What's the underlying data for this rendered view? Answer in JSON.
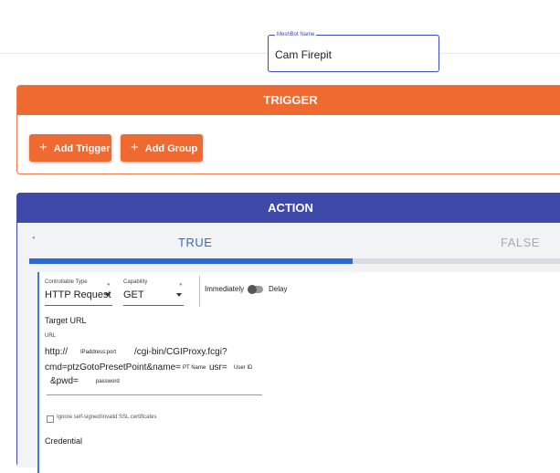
{
  "meshbot_name": {
    "label": "MeshBot Name",
    "value": "Cam Firepit"
  },
  "trigger": {
    "title": "TRIGGER",
    "add_trigger_label": "Add Trigger",
    "add_group_label": "Add Group"
  },
  "action": {
    "title": "ACTION",
    "tabs": {
      "true_label": "TRUE",
      "false_label": "FALSE"
    },
    "progress_fraction": 0.6,
    "form": {
      "controllable_type": {
        "label": "Controllable Type",
        "value": "HTTP Request"
      },
      "capability": {
        "label": "Capability",
        "value": "GET"
      },
      "immediately_label": "Immediately",
      "delay_label": "Delay",
      "target_url_title": "Target URL",
      "url_label": "URL",
      "url": {
        "prefix": "http://",
        "ip_placeholder": "IPaddress:port",
        "path": "/cgi-bin/CGIProxy.fcgi?",
        "cmd": "cmd=ptzGotoPresetPoint&name=",
        "name_placeholder": "PT Name",
        "usr_param": "usr=",
        "user_placeholder": "User ID",
        "pwd_param": "&pwd=",
        "password_placeholder": "password"
      },
      "ssl_label": "Ignore self-signed/invalid SSL certificates",
      "credential_title": "Credential"
    }
  }
}
